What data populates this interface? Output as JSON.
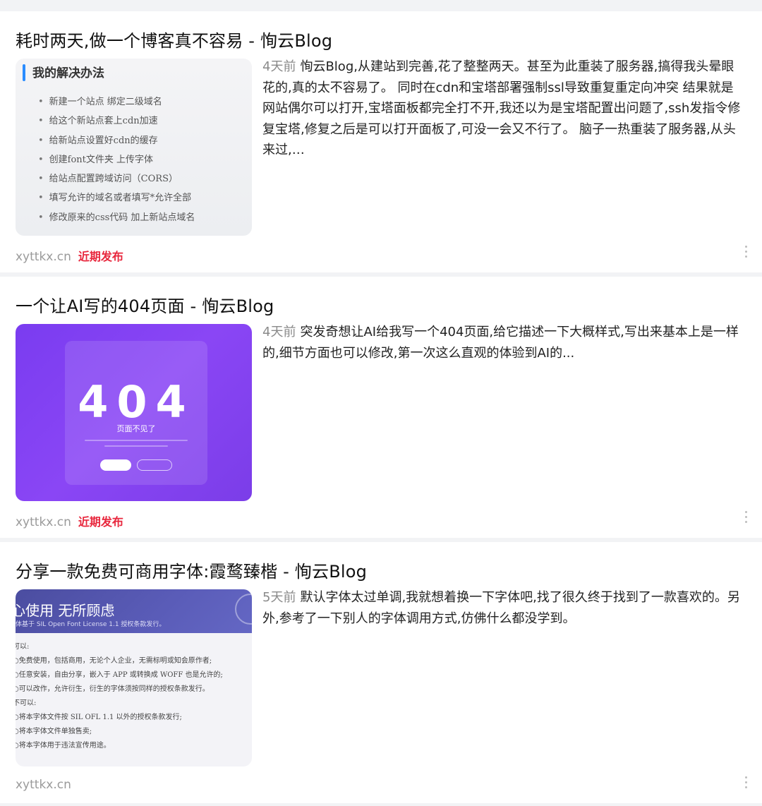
{
  "posts": [
    {
      "title": "耗时两天,做一个博客真不容易 - 恂云Blog",
      "time": "4天前",
      "snippet": "恂云Blog,从建站到完善,花了整整两天。甚至为此重装了服务器,搞得我头晕眼花的,真的太不容易了。 同时在cdn和宝塔部署强制ssl导致重复重定向冲突 结果就是网站偶尔可以打开,宝塔面板都完全打不开,我还以为是宝塔配置出问题了,ssh发指令修复宝塔,修复之后是可以打开面板了,可没一会又不行了。 脑子一热重装了服务器,从头来过,…",
      "site": "xyttkx.cn",
      "tag": "近期发布",
      "thumb": {
        "heading": "我的解决办法",
        "items": [
          "新建一个站点 绑定二级域名",
          "给这个新站点套上cdn加速",
          "给新站点设置好cdn的缓存",
          "创建font文件夹 上传字体",
          "给站点配置跨域访问（CORS）",
          "填写允许的域名或者填写*允许全部",
          "修改原来的css代码 加上新站点域名"
        ]
      }
    },
    {
      "title": "一个让AI写的404页面 - 恂云Blog",
      "time": "4天前",
      "snippet": "突发奇想让AI给我写一个404页面,给它描述一下大概样式,写出来基本上是一样的,细节方面也可以修改,第一次这么直观的体验到AI的...",
      "site": "xyttkx.cn",
      "tag": "近期发布",
      "thumb": {
        "code": "404",
        "subtitle": "页面不见了"
      }
    },
    {
      "title": "分享一款免费可商用字体:霞鹜臻楷 - 恂云Blog",
      "time": "5天前",
      "snippet": "默认字体太过单调,我就想着换一下字体吧,找了很久终于找到了一款喜欢的。另外,参考了一下别人的字体调用方式,仿佛什么都没学到。",
      "site": "xyttkx.cn",
      "tag": "",
      "thumb": {
        "heading": "心使用 无所顾虑",
        "sub": "体基于 SIL Open Font License 1.1 授权条款发行。",
        "lines": [
          "可以:",
          "○免费使用，包括商用，无论个人企业，无需标明或知会原作者;",
          "○任意安装，自由分享，嵌入于 APP 或转换成 WOFF 也是允许的;",
          "○可以改作，允许衍生，衍生的字体须按同样的授权条款发行。",
          "不可以:",
          "○将本字体文件按 SIL OFL 1.1 以外的授权条款发行;",
          "○将本字体文件单独售卖;",
          "○将本字体用于违法宣传用途。"
        ]
      }
    }
  ]
}
